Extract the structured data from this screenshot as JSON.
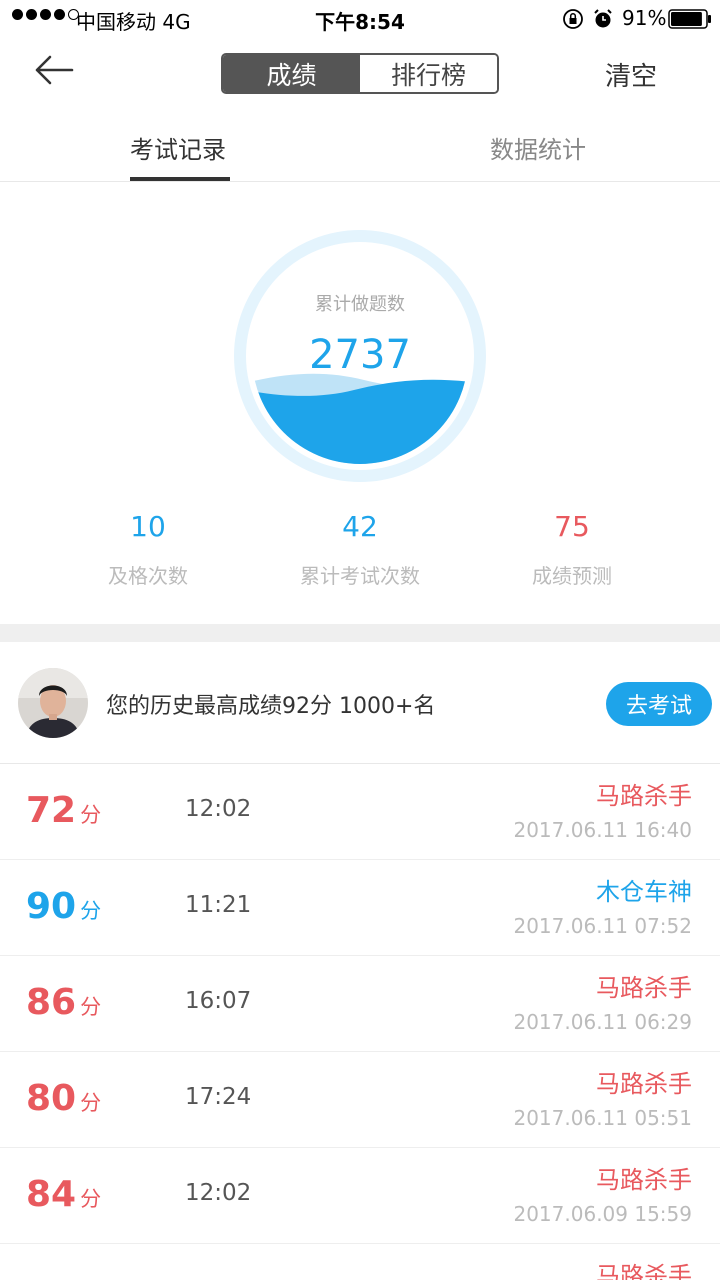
{
  "status_bar": {
    "carrier": "中国移动  4G",
    "time": "下午8:54",
    "battery": "91%",
    "battery_level": 0.91,
    "signal_bars": 4,
    "icons": [
      "lock-rotation-icon",
      "alarm-icon",
      "battery-icon"
    ]
  },
  "nav": {
    "back_icon": "back-arrow-icon",
    "segments": [
      "成绩",
      "排行榜"
    ],
    "active_segment": 0,
    "clear_label": "清空"
  },
  "tabs": [
    "考试记录",
    "数据统计"
  ],
  "gauge": {
    "label": "累计做题数",
    "value": "2737",
    "colors": {
      "ring": "#e4f4fd",
      "water": "#1ea4ea",
      "wave_light": "#bfe3f7"
    }
  },
  "stats": [
    {
      "value": "10",
      "label": "及格次数",
      "color": "#1ea4ea"
    },
    {
      "value": "42",
      "label": "累计考试次数",
      "color": "#1ea4ea"
    },
    {
      "value": "75",
      "label": "成绩预测",
      "color": "#e8595e"
    }
  ],
  "best": {
    "text": "您的历史最高成绩92分 1000+名",
    "button": "去考试"
  },
  "records": [
    {
      "score": "72",
      "unit": "分",
      "duration": "12:02",
      "title": "马路杀手",
      "date": "2017.06.11 16:40",
      "tone": "red"
    },
    {
      "score": "90",
      "unit": "分",
      "duration": "11:21",
      "title": "木仓车神",
      "date": "2017.06.11 07:52",
      "tone": "blue"
    },
    {
      "score": "86",
      "unit": "分",
      "duration": "16:07",
      "title": "马路杀手",
      "date": "2017.06.11 06:29",
      "tone": "red"
    },
    {
      "score": "80",
      "unit": "分",
      "duration": "17:24",
      "title": "马路杀手",
      "date": "2017.06.11 05:51",
      "tone": "red"
    },
    {
      "score": "84",
      "unit": "分",
      "duration": "12:02",
      "title": "马路杀手",
      "date": "2017.06.09 15:59",
      "tone": "red"
    },
    {
      "title": "马路杀手",
      "tone": "red"
    }
  ],
  "colors": {
    "accent": "#1ea4ea",
    "danger": "#e8595e",
    "segment_active": "#555555"
  }
}
